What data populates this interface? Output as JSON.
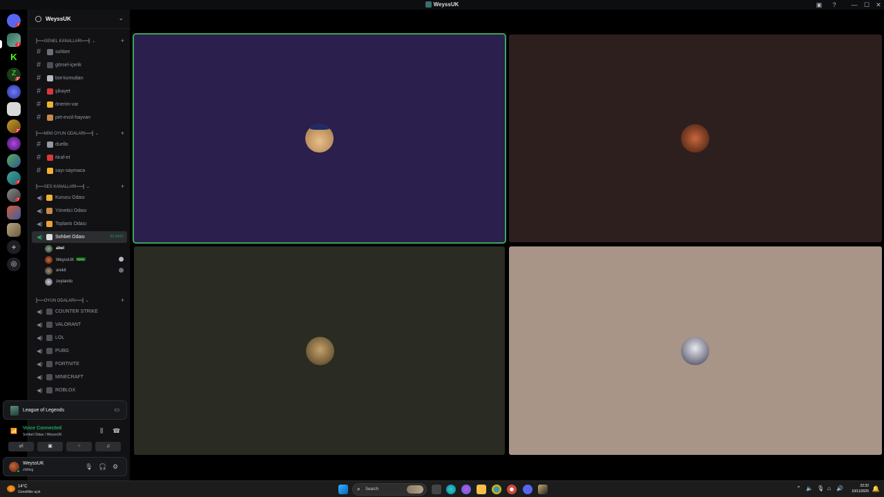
{
  "window": {
    "title": "WeyssUK",
    "controls": [
      "▣",
      "?",
      "—",
      "☐",
      "✕"
    ]
  },
  "server_rail": {
    "badges": [
      "7",
      "1",
      "33",
      "22",
      "1",
      "1"
    ]
  },
  "server": {
    "name": "WeyssUK"
  },
  "categories": {
    "genel": "╠══GENEL KANALLARI══╣",
    "mini_oyun": "╠══MİNİ OYUN ODALARI══╣",
    "ses": "╠══SES KANALLARI══╣",
    "oyun": "╠══OYUN ODALARI══╣"
  },
  "text_channels_genel": [
    {
      "label": "sohbet"
    },
    {
      "label": "görsel-içerik"
    },
    {
      "label": "bot-komutları"
    },
    {
      "label": "şikayet"
    },
    {
      "label": "önerim-var"
    },
    {
      "label": "pet-evcil-hayvan"
    }
  ],
  "text_channels_mini": [
    {
      "label": "duello"
    },
    {
      "label": "itiraf-et"
    },
    {
      "label": "sayı-saymaca"
    }
  ],
  "voice_channels": [
    {
      "label": "Kurucu Odası"
    },
    {
      "label": "Yönetici Odası"
    },
    {
      "label": "Toplantı Odası"
    },
    {
      "label": "Sohbet Odası",
      "timer": "01:24:57"
    }
  ],
  "voice_users": [
    {
      "name": "abel"
    },
    {
      "name": "WeyssUK",
      "tag": "KICK"
    },
    {
      "name": "arekit"
    },
    {
      "name": "zeylando"
    }
  ],
  "game_channels": [
    {
      "label": "COUNTER STRIKE"
    },
    {
      "label": "VALORANT"
    },
    {
      "label": "LOL"
    },
    {
      "label": "PUBG"
    },
    {
      "label": "FORTNITE"
    },
    {
      "label": "MINECRAFT"
    },
    {
      "label": "ROBLOX"
    }
  ],
  "activity": {
    "game": "League of Legends"
  },
  "voice_status": {
    "status": "Voice Connected",
    "channel": "Sohbet Odası / WeyssUK"
  },
  "user_panel": {
    "name": "WeyssUK",
    "status": "chilling"
  },
  "stage_tiles": [
    {
      "color": "#2b1f4e",
      "speaking": true,
      "avatar": "blue-hat-character"
    },
    {
      "color": "#2e1f1f",
      "speaking": false,
      "avatar": "orange-avatar"
    },
    {
      "color": "#2a2b22",
      "speaking": false,
      "avatar": "teddy-bear"
    },
    {
      "color": "#a89587",
      "speaking": false,
      "avatar": "wizard-avatar"
    }
  ],
  "taskbar": {
    "weather_temp": "14°C",
    "weather_desc": "Genellikle açık",
    "search_placeholder": "Search",
    "time": "22:32",
    "date": "10/11/2025"
  },
  "colors": {
    "accent_green": "#23a55a",
    "speaking_outline": "#3ba55c",
    "discord_blurple": "#5865f2"
  }
}
